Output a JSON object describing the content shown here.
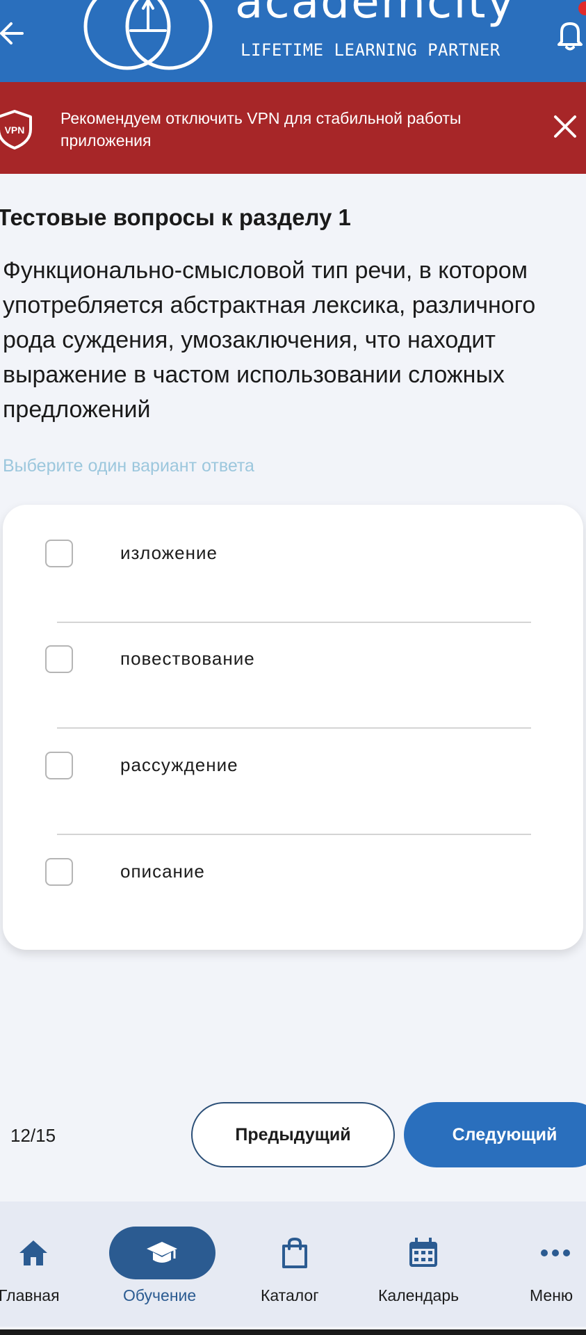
{
  "header": {
    "brand_name": "academcity",
    "brand_tagline": "LIFETIME LEARNING PARTNER",
    "brand_color": "#2a6fbd",
    "icons": {
      "back": "arrow-left-icon",
      "notifications": "bell-icon"
    }
  },
  "banner": {
    "icon_label": "VPN",
    "text": "Рекомендуем отключить VPN для стабильной работы приложения",
    "color": "#a72628"
  },
  "test": {
    "section_title": "Тестовые вопросы к разделу 1",
    "question": "Функционально-смысловой тип речи, в котором употребляется абстрактная лексика, различного рода суждения, умозаключения, что находит выражение в частом использовании сложных предложений",
    "hint": "Выберите один вариант ответа",
    "options": [
      {
        "label": "изложение",
        "checked": false
      },
      {
        "label": "повествование",
        "checked": false
      },
      {
        "label": "рассуждение",
        "checked": false
      },
      {
        "label": "описание",
        "checked": false
      }
    ]
  },
  "navigation": {
    "counter": "12/15",
    "prev_label": "Предыдущий",
    "next_label": "Следующий"
  },
  "tabbar": {
    "active": "Обучение",
    "items": [
      {
        "label": "Главная",
        "icon": "home-icon"
      },
      {
        "label": "Обучение",
        "icon": "graduation-cap-icon"
      },
      {
        "label": "Каталог",
        "icon": "shopping-bag-icon"
      },
      {
        "label": "Календарь",
        "icon": "calendar-icon"
      },
      {
        "label": "Меню",
        "icon": "more-dots-icon"
      }
    ]
  }
}
